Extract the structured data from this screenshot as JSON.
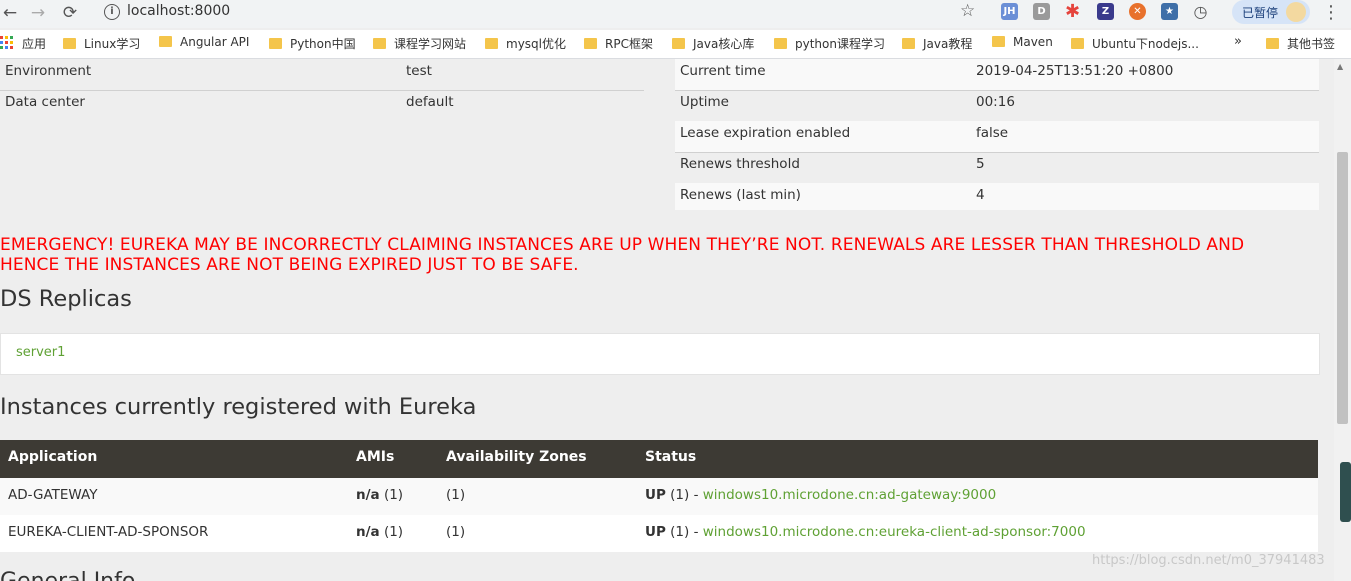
{
  "browser": {
    "url": "localhost:8000",
    "profile_label": "已暂停",
    "extensions": [
      "JH",
      "D",
      "Z"
    ],
    "bookmarks": {
      "apps_label": "应用",
      "items": [
        "Linux学习",
        "Angular API",
        "Python中国",
        "课程学习网站",
        "mysql优化",
        "RPC框架",
        "Java核心库",
        "python课程学习",
        "Java教程",
        "Maven",
        "Ubuntu下nodejs..."
      ],
      "overflow": "»",
      "other": "其他书签"
    }
  },
  "env_table": [
    {
      "label": "Environment",
      "value": "test"
    },
    {
      "label": "Data center",
      "value": "default"
    }
  ],
  "status_table": [
    {
      "label": "Current time",
      "value": "2019-04-25T13:51:20 +0800"
    },
    {
      "label": "Uptime",
      "value": "00:16"
    },
    {
      "label": "Lease expiration enabled",
      "value": "false"
    },
    {
      "label": "Renews threshold",
      "value": "5"
    },
    {
      "label": "Renews (last min)",
      "value": "4"
    }
  ],
  "emergency": {
    "line1": "EMERGENCY! EUREKA MAY BE INCORRECTLY CLAIMING INSTANCES ARE UP WHEN THEY’RE NOT. RENEWALS ARE LESSER THAN THRESHOLD AND",
    "line2": "HENCE THE INSTANCES ARE NOT BEING EXPIRED JUST TO BE SAFE."
  },
  "replicas": {
    "title": "DS Replicas",
    "items": [
      "server1"
    ]
  },
  "instances": {
    "title": "Instances currently registered with Eureka",
    "headers": [
      "Application",
      "AMIs",
      "Availability Zones",
      "Status"
    ],
    "rows": [
      {
        "application": "AD-GATEWAY",
        "amis_bold": "n/a",
        "amis_count": " (1)",
        "zones": "(1)",
        "status_bold": "UP",
        "status_count": " (1) - ",
        "link": "windows10.microdone.cn:ad-gateway:9000"
      },
      {
        "application": "EUREKA-CLIENT-AD-SPONSOR",
        "amis_bold": "n/a",
        "amis_count": " (1)",
        "zones": "(1)",
        "status_bold": "UP",
        "status_count": " (1) - ",
        "link": "windows10.microdone.cn:eureka-client-ad-sponsor:7000"
      }
    ]
  },
  "next_section_partial": "General Info",
  "watermark": "https://blog.csdn.net/m0_37941483",
  "colors": {
    "accent_green": "#5fa134",
    "header_dark": "#3d3a34",
    "alert_red": "#ff0000"
  }
}
